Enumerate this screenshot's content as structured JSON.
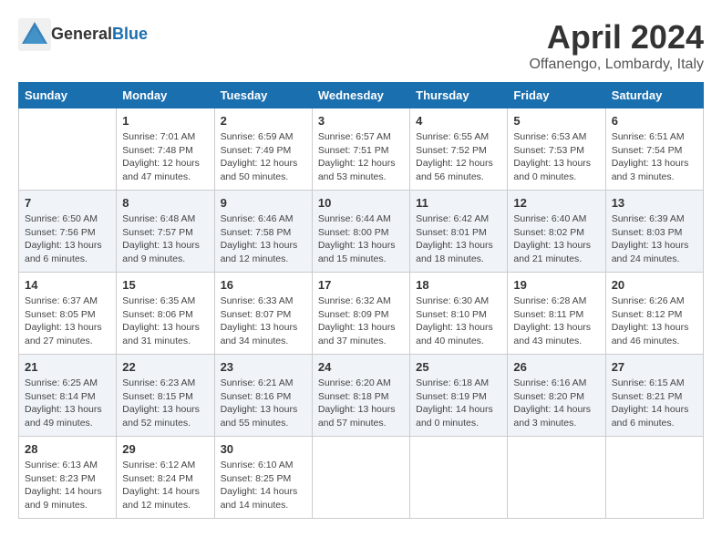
{
  "logo": {
    "text_general": "General",
    "text_blue": "Blue"
  },
  "title": "April 2024",
  "location": "Offanengo, Lombardy, Italy",
  "weekdays": [
    "Sunday",
    "Monday",
    "Tuesday",
    "Wednesday",
    "Thursday",
    "Friday",
    "Saturday"
  ],
  "weeks": [
    [
      {
        "day": "",
        "info": ""
      },
      {
        "day": "1",
        "info": "Sunrise: 7:01 AM\nSunset: 7:48 PM\nDaylight: 12 hours\nand 47 minutes."
      },
      {
        "day": "2",
        "info": "Sunrise: 6:59 AM\nSunset: 7:49 PM\nDaylight: 12 hours\nand 50 minutes."
      },
      {
        "day": "3",
        "info": "Sunrise: 6:57 AM\nSunset: 7:51 PM\nDaylight: 12 hours\nand 53 minutes."
      },
      {
        "day": "4",
        "info": "Sunrise: 6:55 AM\nSunset: 7:52 PM\nDaylight: 12 hours\nand 56 minutes."
      },
      {
        "day": "5",
        "info": "Sunrise: 6:53 AM\nSunset: 7:53 PM\nDaylight: 13 hours\nand 0 minutes."
      },
      {
        "day": "6",
        "info": "Sunrise: 6:51 AM\nSunset: 7:54 PM\nDaylight: 13 hours\nand 3 minutes."
      }
    ],
    [
      {
        "day": "7",
        "info": "Sunrise: 6:50 AM\nSunset: 7:56 PM\nDaylight: 13 hours\nand 6 minutes."
      },
      {
        "day": "8",
        "info": "Sunrise: 6:48 AM\nSunset: 7:57 PM\nDaylight: 13 hours\nand 9 minutes."
      },
      {
        "day": "9",
        "info": "Sunrise: 6:46 AM\nSunset: 7:58 PM\nDaylight: 13 hours\nand 12 minutes."
      },
      {
        "day": "10",
        "info": "Sunrise: 6:44 AM\nSunset: 8:00 PM\nDaylight: 13 hours\nand 15 minutes."
      },
      {
        "day": "11",
        "info": "Sunrise: 6:42 AM\nSunset: 8:01 PM\nDaylight: 13 hours\nand 18 minutes."
      },
      {
        "day": "12",
        "info": "Sunrise: 6:40 AM\nSunset: 8:02 PM\nDaylight: 13 hours\nand 21 minutes."
      },
      {
        "day": "13",
        "info": "Sunrise: 6:39 AM\nSunset: 8:03 PM\nDaylight: 13 hours\nand 24 minutes."
      }
    ],
    [
      {
        "day": "14",
        "info": "Sunrise: 6:37 AM\nSunset: 8:05 PM\nDaylight: 13 hours\nand 27 minutes."
      },
      {
        "day": "15",
        "info": "Sunrise: 6:35 AM\nSunset: 8:06 PM\nDaylight: 13 hours\nand 31 minutes."
      },
      {
        "day": "16",
        "info": "Sunrise: 6:33 AM\nSunset: 8:07 PM\nDaylight: 13 hours\nand 34 minutes."
      },
      {
        "day": "17",
        "info": "Sunrise: 6:32 AM\nSunset: 8:09 PM\nDaylight: 13 hours\nand 37 minutes."
      },
      {
        "day": "18",
        "info": "Sunrise: 6:30 AM\nSunset: 8:10 PM\nDaylight: 13 hours\nand 40 minutes."
      },
      {
        "day": "19",
        "info": "Sunrise: 6:28 AM\nSunset: 8:11 PM\nDaylight: 13 hours\nand 43 minutes."
      },
      {
        "day": "20",
        "info": "Sunrise: 6:26 AM\nSunset: 8:12 PM\nDaylight: 13 hours\nand 46 minutes."
      }
    ],
    [
      {
        "day": "21",
        "info": "Sunrise: 6:25 AM\nSunset: 8:14 PM\nDaylight: 13 hours\nand 49 minutes."
      },
      {
        "day": "22",
        "info": "Sunrise: 6:23 AM\nSunset: 8:15 PM\nDaylight: 13 hours\nand 52 minutes."
      },
      {
        "day": "23",
        "info": "Sunrise: 6:21 AM\nSunset: 8:16 PM\nDaylight: 13 hours\nand 55 minutes."
      },
      {
        "day": "24",
        "info": "Sunrise: 6:20 AM\nSunset: 8:18 PM\nDaylight: 13 hours\nand 57 minutes."
      },
      {
        "day": "25",
        "info": "Sunrise: 6:18 AM\nSunset: 8:19 PM\nDaylight: 14 hours\nand 0 minutes."
      },
      {
        "day": "26",
        "info": "Sunrise: 6:16 AM\nSunset: 8:20 PM\nDaylight: 14 hours\nand 3 minutes."
      },
      {
        "day": "27",
        "info": "Sunrise: 6:15 AM\nSunset: 8:21 PM\nDaylight: 14 hours\nand 6 minutes."
      }
    ],
    [
      {
        "day": "28",
        "info": "Sunrise: 6:13 AM\nSunset: 8:23 PM\nDaylight: 14 hours\nand 9 minutes."
      },
      {
        "day": "29",
        "info": "Sunrise: 6:12 AM\nSunset: 8:24 PM\nDaylight: 14 hours\nand 12 minutes."
      },
      {
        "day": "30",
        "info": "Sunrise: 6:10 AM\nSunset: 8:25 PM\nDaylight: 14 hours\nand 14 minutes."
      },
      {
        "day": "",
        "info": ""
      },
      {
        "day": "",
        "info": ""
      },
      {
        "day": "",
        "info": ""
      },
      {
        "day": "",
        "info": ""
      }
    ]
  ]
}
